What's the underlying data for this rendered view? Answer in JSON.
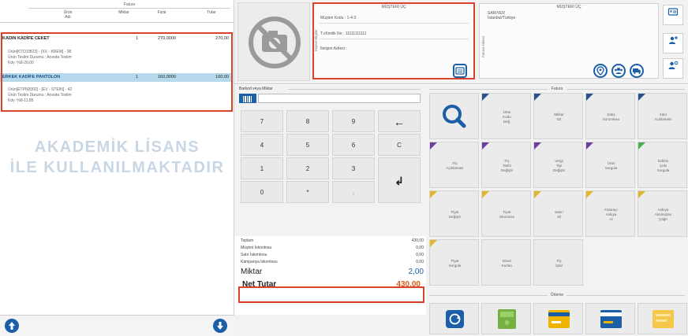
{
  "invoice": {
    "title": "Fatura",
    "columns": {
      "adi": "Ürün\nAdı",
      "miktar": "Miktar",
      "fiyat": "Fiyat",
      "tutar": "Tutar"
    },
    "items": [
      {
        "name": "KADIN KADİFE CEKET",
        "qty": "1",
        "price": "270,0000",
        "total": "270,00",
        "details": [
          "Ürün[KTC03823] - [XX - KREM] - 38",
          "Ürün Teslim Durumu : Anında Teslim",
          "Kdv :%8-20,00"
        ]
      },
      {
        "name": "ERKEK KADİFE PANTOLON",
        "qty": "1",
        "price": "160,0000",
        "total": "160,00",
        "details": [
          "Ürün[ETPN2002] - [EV - STEIN] - 42",
          "Ürün Teslim Durumu : Anında Teslim",
          "Kdv :%8-11,85"
        ]
      }
    ],
    "watermark_line1": "AKADEMİK LİSANS",
    "watermark_line2": "İLE KULLANILMAKTADIR"
  },
  "customer": {
    "left_card_title": "MÜŞTERİ ÜÇ",
    "left_vertical_label": "Kişisel Bilgiler",
    "kod_label": "Müşteri Kodu",
    "kod_value": "1-4-3",
    "tckn_label": "T.cKimlik No",
    "tckn_value": "11111111111",
    "iletisim_label": "İletişim Adresi",
    "right_card_title": "MÜŞTERİ ÜÇ",
    "right_vertical_label": "Fatura Adresi",
    "address_line1": "SARIYER",
    "address_line2": "İstanbul/Türkiye"
  },
  "barcode": {
    "label": "Barkod veya Miktar"
  },
  "keypad": {
    "keys": [
      "7",
      "8",
      "9",
      "←",
      "4",
      "5",
      "6",
      "C",
      "1",
      "2",
      "3",
      "↲",
      "0",
      "*",
      "."
    ]
  },
  "totals": {
    "toplam_label": "Toplam",
    "toplam_value": "430,00",
    "musteri_iskonto_label": "Müşteri İskontosu",
    "musteri_iskonto_value": "0,00",
    "satir_iskonto_label": "Satır İskontosu",
    "satir_iskonto_value": "0,00",
    "kampanya_iskonto_label": "Kampanya İskontosu",
    "kampanya_iskonto_value": "0,00",
    "miktar_label": "Miktar",
    "miktar_value": "2,00",
    "net_label": "Net Tutar",
    "net_value": "430,00"
  },
  "actions": {
    "title": "Fatura",
    "buttons": [
      {
        "label": "",
        "icon": "search-icon",
        "triangle": "none"
      },
      {
        "label": "Ürün\nKodu\nDeğ.",
        "triangle": "#2b4f8f"
      },
      {
        "label": "Miktar\nGir",
        "triangle": "#2b4f8f"
      },
      {
        "label": "Satış\nSorumlusu",
        "triangle": "#2b4f8f"
      },
      {
        "label": "Satır\nAçıklaması",
        "triangle": "#2b4f8f"
      },
      {
        "label": "Fiş\nAçıklaması",
        "triangle": "#6b3fa0"
      },
      {
        "label": "Fiş\nTarihi\nDeğiştir",
        "triangle": "#6b3fa0"
      },
      {
        "label": "Vergi\nTipi\nDeğiştir",
        "triangle": "#6b3fa0"
      },
      {
        "label": "Ürün\nSorgula",
        "triangle": "#6b3fa0"
      },
      {
        "label": "İndirim\nÇeki\nSorgula",
        "triangle": "#4caf50"
      },
      {
        "label": "Fiyat\nDeğiştir",
        "triangle": "#e0b72a"
      },
      {
        "label": "Fiyat\nİskontosu",
        "triangle": "#e0b72a"
      },
      {
        "label": "Satırı\nSil",
        "triangle": "#e0b72a"
      },
      {
        "label": "Faturayı\nAskıya\nAl",
        "triangle": "#e0b72a"
      },
      {
        "label": "Askıya\nAlınmıştan\nÇağır",
        "triangle": "#e0b72a"
      },
      {
        "label": "Fiyat\nSorgula",
        "triangle": "#e0b72a"
      },
      {
        "label": "Döviz\nKurları",
        "triangle": "none"
      },
      {
        "label": "Fiş\nİptal",
        "triangle": "none"
      }
    ],
    "odeme_title": "Ödeme"
  }
}
